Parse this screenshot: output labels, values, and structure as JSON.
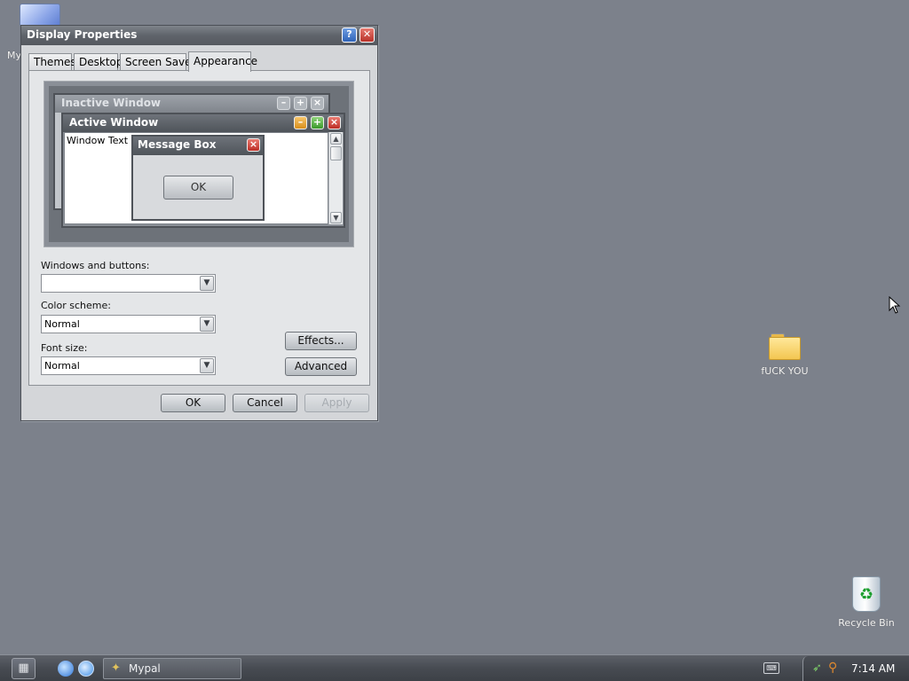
{
  "desktop": {
    "icons": [
      {
        "label": "My"
      },
      {
        "label": "fUCK YOU"
      },
      {
        "label": "Recycle Bin"
      }
    ]
  },
  "window": {
    "title": "Display Properties",
    "tabs": [
      {
        "label": "Themes"
      },
      {
        "label": "Desktop"
      },
      {
        "label": "Screen Saver"
      },
      {
        "label": "Appearance",
        "active": true
      }
    ],
    "preview": {
      "inactive_title": "Inactive Window",
      "active_title": "Active Window",
      "window_text": "Window Text",
      "message_title": "Message Box",
      "message_ok": "OK"
    },
    "fields": {
      "windows_buttons_label": "Windows and buttons:",
      "windows_buttons_value": "",
      "color_scheme_label": "Color scheme:",
      "color_scheme_value": "Normal",
      "font_size_label": "Font size:",
      "font_size_value": "Normal"
    },
    "buttons": {
      "effects": "Effects...",
      "advanced": "Advanced",
      "ok": "OK",
      "cancel": "Cancel",
      "apply": "Apply"
    }
  },
  "taskbar": {
    "task_label": "Mypal",
    "clock": "7:14 AM"
  },
  "colors": {
    "desktop": "#7c818b",
    "titlebar": "#5f646b",
    "close": "#b8322a",
    "help": "#2f63b8"
  },
  "icon_names": [
    "computer-icon",
    "folder-icon",
    "recycle-bin-icon",
    "start-icon",
    "browser-icon",
    "keyboard-icon",
    "clock-tray"
  ]
}
